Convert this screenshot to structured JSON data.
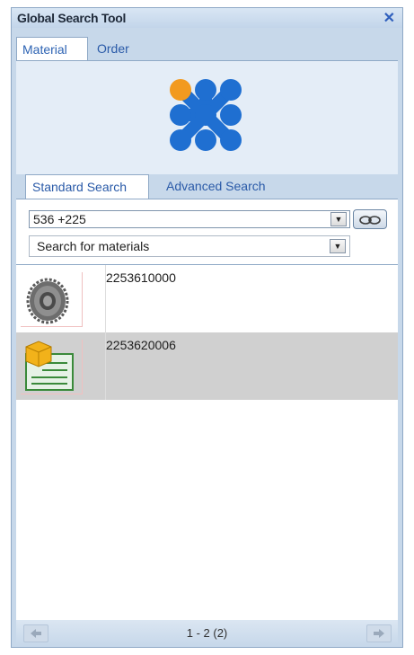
{
  "window": {
    "title": "Global Search Tool",
    "close_label": "✕"
  },
  "tabs": [
    {
      "label": "Material",
      "active": true
    },
    {
      "label": "Order",
      "active": false
    }
  ],
  "search_tabs": [
    {
      "label": "Standard Search",
      "active": true
    },
    {
      "label": "Advanced Search",
      "active": false
    }
  ],
  "search": {
    "query": "536 +225",
    "scope_selected": "Search for materials"
  },
  "results": [
    {
      "id": "2253610000",
      "icon": "gear-part-icon",
      "selected": false
    },
    {
      "id": "2253620006",
      "icon": "material-document-icon",
      "selected": true
    }
  ],
  "pager": {
    "info": "1 - 2 (2)"
  },
  "colors": {
    "accent": "#2d63b3",
    "logo_blue": "#1f6fd1",
    "logo_orange": "#f29a1f",
    "selected_row": "#d0d0d0"
  }
}
